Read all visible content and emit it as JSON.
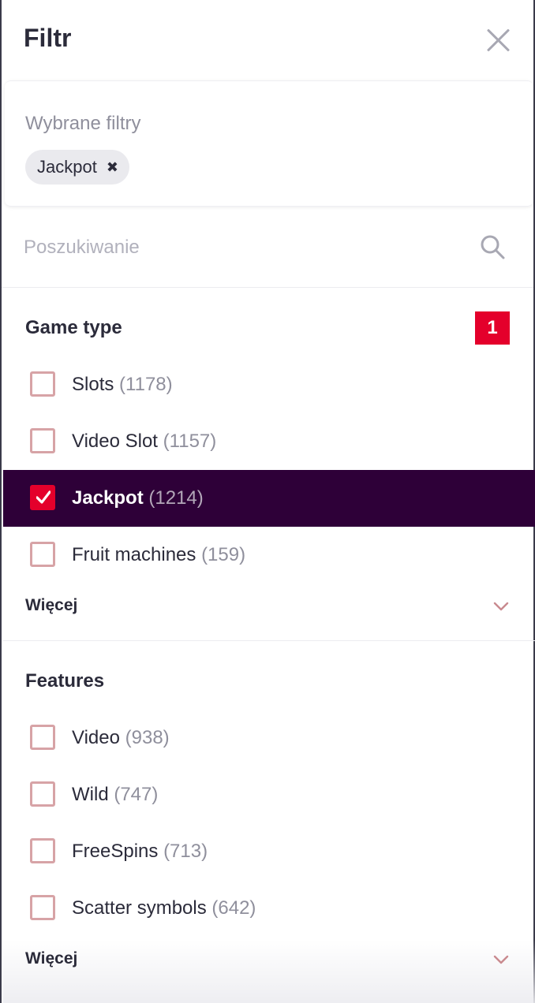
{
  "header": {
    "title": "Filtr"
  },
  "selected": {
    "label": "Wybrane filtry",
    "chips": [
      {
        "label": "Jackpot",
        "remove_icon": "✖"
      }
    ]
  },
  "search": {
    "placeholder": "Poszukiwanie"
  },
  "sections": [
    {
      "title": "Game type",
      "badge": "1",
      "options": [
        {
          "label": "Slots",
          "count": "(1178)",
          "checked": false
        },
        {
          "label": "Video Slot",
          "count": "(1157)",
          "checked": false
        },
        {
          "label": "Jackpot",
          "count": "(1214)",
          "checked": true
        },
        {
          "label": "Fruit machines",
          "count": "(159)",
          "checked": false
        }
      ],
      "more_label": "Więcej"
    },
    {
      "title": "Features",
      "options": [
        {
          "label": "Video",
          "count": "(938)",
          "checked": false
        },
        {
          "label": "Wild",
          "count": "(747)",
          "checked": false
        },
        {
          "label": "FreeSpins",
          "count": "(713)",
          "checked": false
        },
        {
          "label": "Scatter symbols",
          "count": "(642)",
          "checked": false
        }
      ],
      "more_label": "Więcej"
    }
  ],
  "colors": {
    "accent": "#e4002b",
    "active_row_bg": "#2e0038",
    "checkbox_border": "#d7a3a6",
    "chevron": "#c98a8f",
    "muted_text": "#8f8f9c"
  },
  "icons": {
    "close": "close-icon",
    "search": "search-icon",
    "check": "check-icon",
    "expand": "chevron-down-icon"
  }
}
